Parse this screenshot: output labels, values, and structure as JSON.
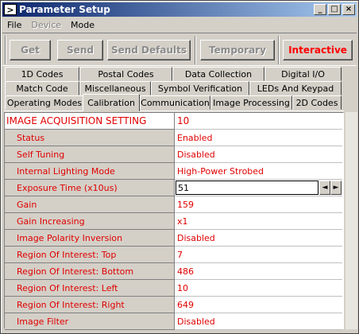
{
  "window": {
    "title": "Parameter Setup",
    "buttons": {
      "minimize": "_",
      "maximize": "□",
      "close": "×"
    }
  },
  "menu": [
    "File",
    "Device",
    "Mode"
  ],
  "toolbar": {
    "get": "Get",
    "send": "Send",
    "send_defaults": "Send Defaults",
    "temporary": "Temporary",
    "interactive": "Interactive"
  },
  "tabs": {
    "row1": [
      "1D Codes",
      "Postal Codes",
      "Data Collection",
      "Digital I/O"
    ],
    "row2": [
      "Match Code",
      "Miscellaneous",
      "Symbol Verification",
      "LEDs And Keypad"
    ],
    "row3": [
      "Operating Modes",
      "Calibration",
      "Communication",
      "Image Processing",
      "2D Codes"
    ],
    "selected": "Calibration"
  },
  "grid": {
    "header": {
      "name": "IMAGE ACQUISITION SETTING",
      "value": "10"
    },
    "rows": [
      {
        "name": "Status",
        "value": "Enabled"
      },
      {
        "name": "Self Tuning",
        "value": "Disabled"
      },
      {
        "name": "Internal Lighting Mode",
        "value": "High-Power Strobed"
      },
      {
        "name": "Exposure Time (x10us)",
        "value": "51"
      },
      {
        "name": "Gain",
        "value": "159"
      },
      {
        "name": "Gain Increasing",
        "value": "x1"
      },
      {
        "name": "Image Polarity Inversion",
        "value": "Disabled"
      },
      {
        "name": "Region Of Interest: Top",
        "value": "7"
      },
      {
        "name": "Region Of Interest: Bottom",
        "value": "486"
      },
      {
        "name": "Region Of Interest: Left",
        "value": "10"
      },
      {
        "name": "Region Of Interest: Right",
        "value": "649"
      },
      {
        "name": "Image Filter",
        "value": "Disabled"
      }
    ],
    "editing_row": "Exposure Time (x10us)",
    "spin_left": "◄",
    "spin_right": "►"
  },
  "colors": {
    "accent_red": "#e00000",
    "titlebar_start": "#0a246a",
    "titlebar_end": "#a6caf0",
    "face": "#d4d0c8"
  }
}
